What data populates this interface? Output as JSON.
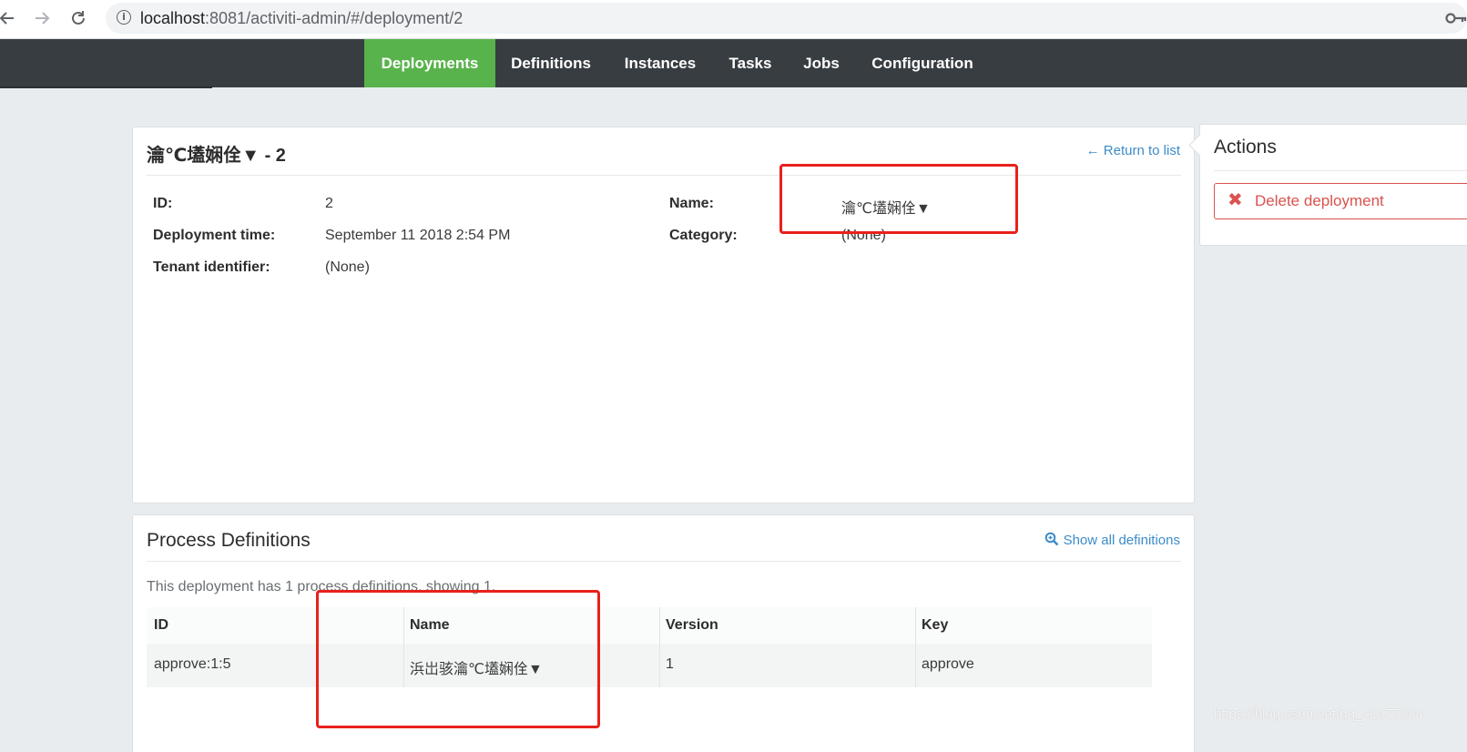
{
  "browser": {
    "url_host": "localhost",
    "url_rest": ":8081/activiti-admin/#/deployment/2"
  },
  "nav": {
    "tabs": [
      {
        "label": "Deployments",
        "active": true
      },
      {
        "label": "Definitions",
        "active": false
      },
      {
        "label": "Instances",
        "active": false
      },
      {
        "label": "Tasks",
        "active": false
      },
      {
        "label": "Jobs",
        "active": false
      },
      {
        "label": "Configuration",
        "active": false
      }
    ]
  },
  "deployment": {
    "title": "瀹℃壒娴佺▼ - 2",
    "return_link": "← Return to list",
    "fields": {
      "id_label": "ID:",
      "id_value": "2",
      "time_label": "Deployment time:",
      "time_value": "September 11 2018 2:54 PM",
      "tenant_label": "Tenant identifier:",
      "tenant_value": "(None)",
      "name_label": "Name:",
      "name_value": "瀹℃壒娴佺▼",
      "category_label": "Category:",
      "category_value": "(None)"
    }
  },
  "actions": {
    "title": "Actions",
    "delete_label": "Delete deployment",
    "delete_icon": "✖"
  },
  "process_definitions": {
    "title": "Process Definitions",
    "show_all_link": "Show all definitions",
    "summary": "This deployment has 1 process definitions, showing 1.",
    "columns": [
      "ID",
      "Name",
      "Version",
      "Key"
    ],
    "rows": [
      {
        "id": "approve:1:5",
        "name": "浜岀骇瀹℃壒娴佺▼",
        "version": "1",
        "key": "approve"
      }
    ]
  },
  "watermark": "https://blog.csdn.net/qq_41477034",
  "colors": {
    "accent_green": "#59b34c",
    "nav_dark": "#383d41",
    "link_blue": "#3d8cc8",
    "danger_red": "#d9534f",
    "highlight_red": "#e8211b"
  }
}
